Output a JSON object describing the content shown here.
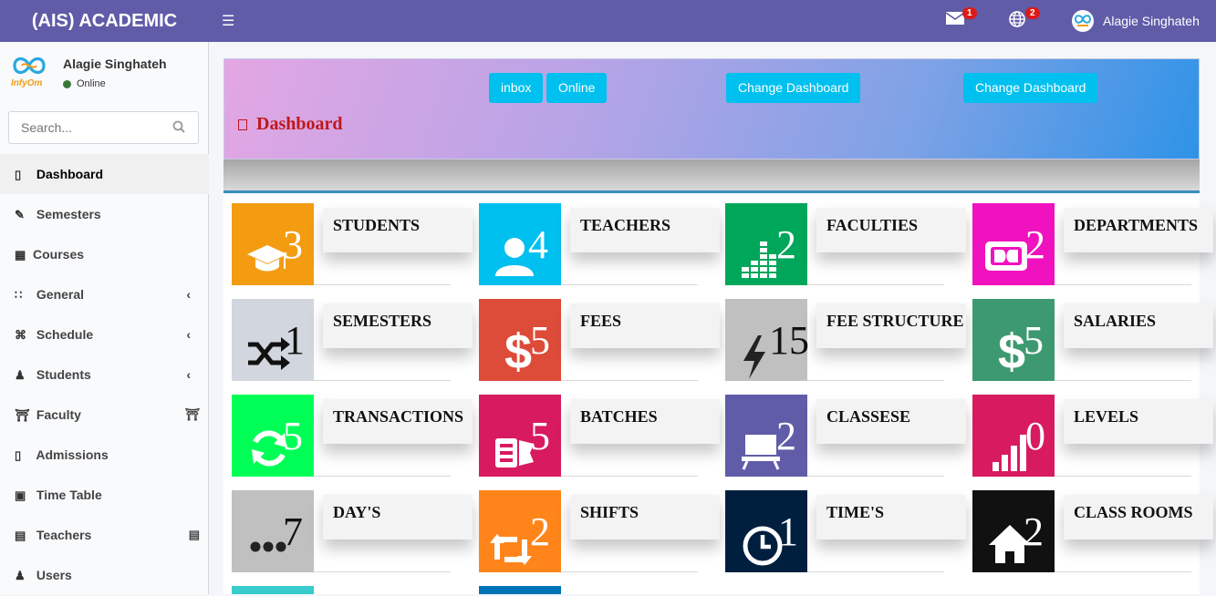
{
  "topbar": {
    "brand": "(AIS) ACADEMIC",
    "mail_badge": "1",
    "globe_badge": "2",
    "user_name": "Alagie Singhateh"
  },
  "sidebar": {
    "user_name": "Alagie Singhateh",
    "status": "Online",
    "search_placeholder": "Search...",
    "items": [
      {
        "label": "Dashboard",
        "icon": "file-icon"
      },
      {
        "label": "Semesters",
        "icon": "edit-icon"
      },
      {
        "label": "Courses",
        "icon": "grid-icon"
      },
      {
        "label": "General",
        "icon": "dots-icon"
      },
      {
        "label": "Schedule",
        "icon": "compress-icon"
      },
      {
        "label": "Students",
        "icon": "users-icon"
      },
      {
        "label": "Faculty",
        "icon": "bank-icon"
      },
      {
        "label": "Admissions",
        "icon": "file-icon"
      },
      {
        "label": "Time Table",
        "icon": "calendar-icon"
      },
      {
        "label": "Teachers",
        "icon": "briefcase-icon"
      },
      {
        "label": "Users",
        "icon": "user-icon"
      }
    ]
  },
  "header": {
    "buttons": [
      "inbox",
      "Online",
      "Change Dashboard",
      "Change Dashboard"
    ],
    "title": "Dashboard"
  },
  "tiles": [
    {
      "label": "STUDENTS",
      "count": "3",
      "color": "#f39c12",
      "icon": "graduation-cap-icon"
    },
    {
      "label": "TEACHERS",
      "count": "4",
      "color": "#00c0ef",
      "icon": "user-icon"
    },
    {
      "label": "FACULTIES",
      "count": "2",
      "color": "#00a65a",
      "icon": "bars-icon"
    },
    {
      "label": "DEPARTMENTS",
      "count": "2",
      "color": "#f012be",
      "icon": "dolby-icon"
    },
    {
      "label": "SEMESTERS",
      "count": "1",
      "color": "#d2d6de",
      "icon": "shuffle-icon"
    },
    {
      "label": "FEES",
      "count": "5",
      "color": "#dd4b39",
      "icon": "dollar-icon"
    },
    {
      "label": "FEE STRUCTURE",
      "count": "15",
      "color": "#c0c0c0",
      "icon": "bolt-icon"
    },
    {
      "label": "SALARIES",
      "count": "5",
      "color": "#3d9970",
      "icon": "dollar-icon"
    },
    {
      "label": "TRANSACTIONS",
      "count": "5",
      "color": "#00ff56",
      "icon": "refresh-icon"
    },
    {
      "label": "BATCHES",
      "count": "5",
      "color": "#d81b60",
      "icon": "ticket-icon"
    },
    {
      "label": "CLASSESE",
      "count": "2",
      "color": "#605ca8",
      "icon": "desk-icon"
    },
    {
      "label": "LEVELS",
      "count": "0",
      "color": "#d81b60",
      "icon": "signal-icon"
    },
    {
      "label": "DAY'S",
      "count": "7",
      "color": "#c0c0c0",
      "icon": "ellipsis-icon"
    },
    {
      "label": "SHIFTS",
      "count": "2",
      "color": "#ff851b",
      "icon": "retweet-icon"
    },
    {
      "label": "TIME'S",
      "count": "1",
      "color": "#001f3f",
      "icon": "clock-icon"
    },
    {
      "label": "CLASS ROOMS",
      "count": "2",
      "color": "#111111",
      "icon": "home-icon"
    }
  ]
}
